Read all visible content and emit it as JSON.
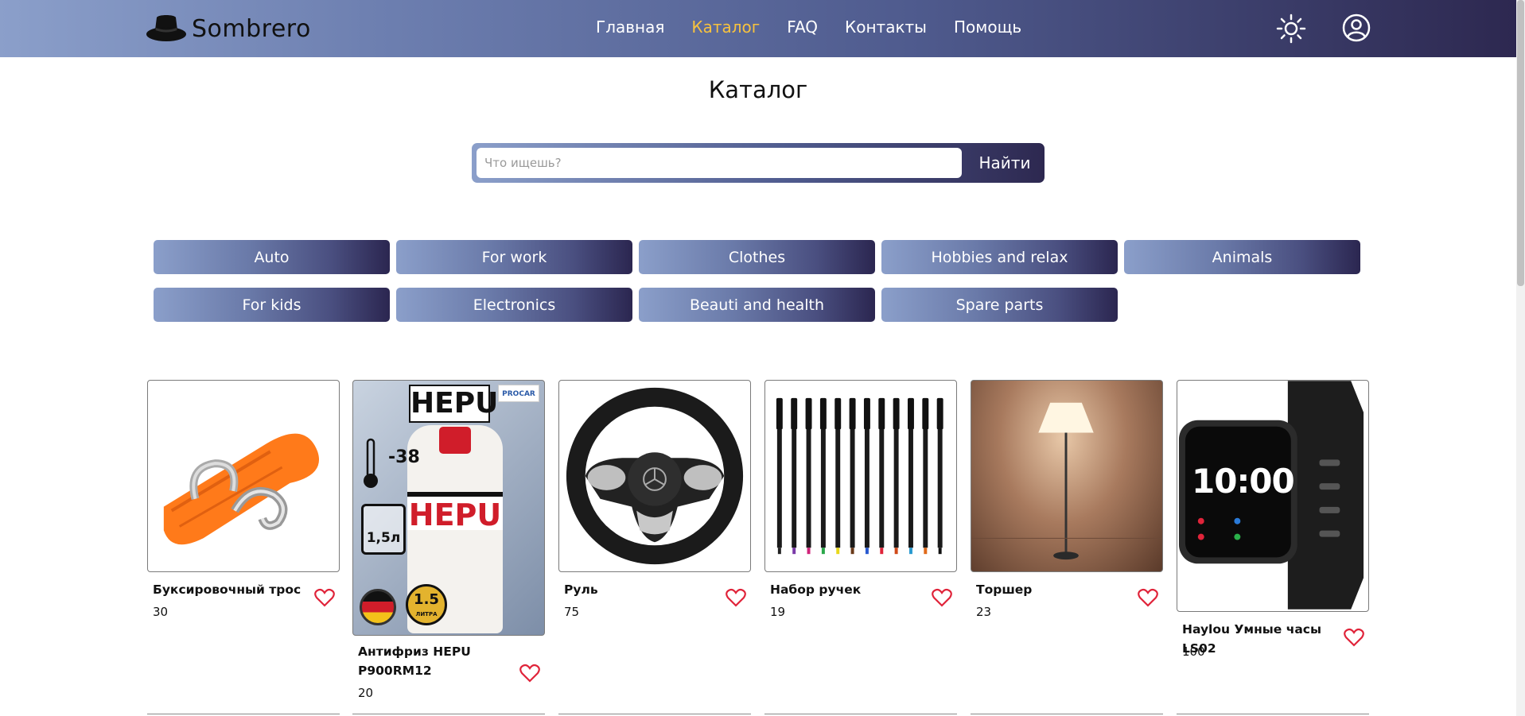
{
  "header": {
    "logo_text": "Sombrero",
    "nav": [
      "Главная",
      "Каталог",
      "FAQ",
      "Контакты",
      "Помощь"
    ],
    "active_nav": "Каталог",
    "icons": [
      "hat-logo-icon",
      "sun-icon",
      "user-icon"
    ]
  },
  "page": {
    "title": "Каталог"
  },
  "search": {
    "placeholder": "Что ищешь?",
    "button_label": "Найти"
  },
  "categories": [
    "Auto",
    "For work",
    "Clothes",
    "Hobbies and relax",
    "Animals",
    "For kids",
    "Electronics",
    "Beauti and health",
    "Spare parts"
  ],
  "products": [
    {
      "name": "Буксировочный трос",
      "price": "30",
      "image": "tow-strap-image"
    },
    {
      "name": "Антифриз HEPU P900RM12",
      "price": "20",
      "image": "antifreeze-bottle-image",
      "image_text": {
        "brand": "HEPU",
        "badge": "PROCAR",
        "temp": "-38",
        "volume": "1,5л",
        "liters": "1.5",
        "liters_unit": "ЛИТРА"
      }
    },
    {
      "name": "Руль",
      "price": "75",
      "image": "steering-wheel-image"
    },
    {
      "name": "Набор ручек",
      "price": "19",
      "image": "pen-set-image"
    },
    {
      "name": "Торшер",
      "price": "23",
      "image": "floor-lamp-image"
    },
    {
      "name": "Haylou Умные часы LS02",
      "price": "100",
      "image": "smart-watch-image",
      "image_text": {
        "time": "10:00"
      }
    }
  ],
  "colors": {
    "accent": "#f7c23e",
    "gradient_start": "#8b9fca",
    "gradient_end": "#2d2850",
    "heart": "#e0243a"
  }
}
